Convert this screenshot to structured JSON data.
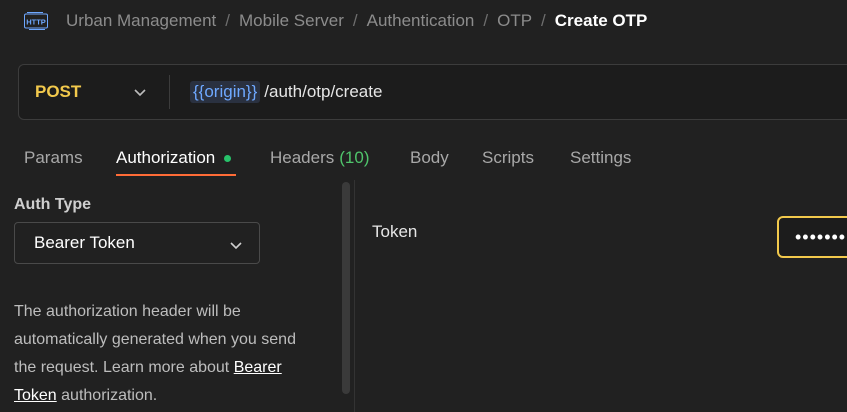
{
  "breadcrumb": {
    "items": [
      "Urban Management",
      "Mobile Server",
      "Authentication",
      "OTP"
    ],
    "current": "Create OTP",
    "separator": "/"
  },
  "request": {
    "method": "POST",
    "url_variable": "{{origin}}",
    "url_path": "/auth/otp/create"
  },
  "tabs": [
    {
      "label": "Params"
    },
    {
      "label": "Authorization",
      "active": true,
      "indicator": "green-dot"
    },
    {
      "label": "Headers",
      "count": "(10)"
    },
    {
      "label": "Body"
    },
    {
      "label": "Scripts"
    },
    {
      "label": "Settings"
    }
  ],
  "auth": {
    "type_label": "Auth Type",
    "selected_type": "Bearer Token",
    "description_1": "The authorization header will be automatically generated when you send the request. Learn more about ",
    "link_text": "Bearer Token",
    "description_2": " authorization."
  },
  "token": {
    "label": "Token",
    "masked_value": "•••••••"
  },
  "colors": {
    "method": "#f2c94c",
    "active_tab_underline": "#ff6c37",
    "indicator_dot": "#27c26a",
    "header_count": "#4fc46b",
    "variable": "#6ea8ff",
    "token_focus_border": "#f2c94c"
  }
}
